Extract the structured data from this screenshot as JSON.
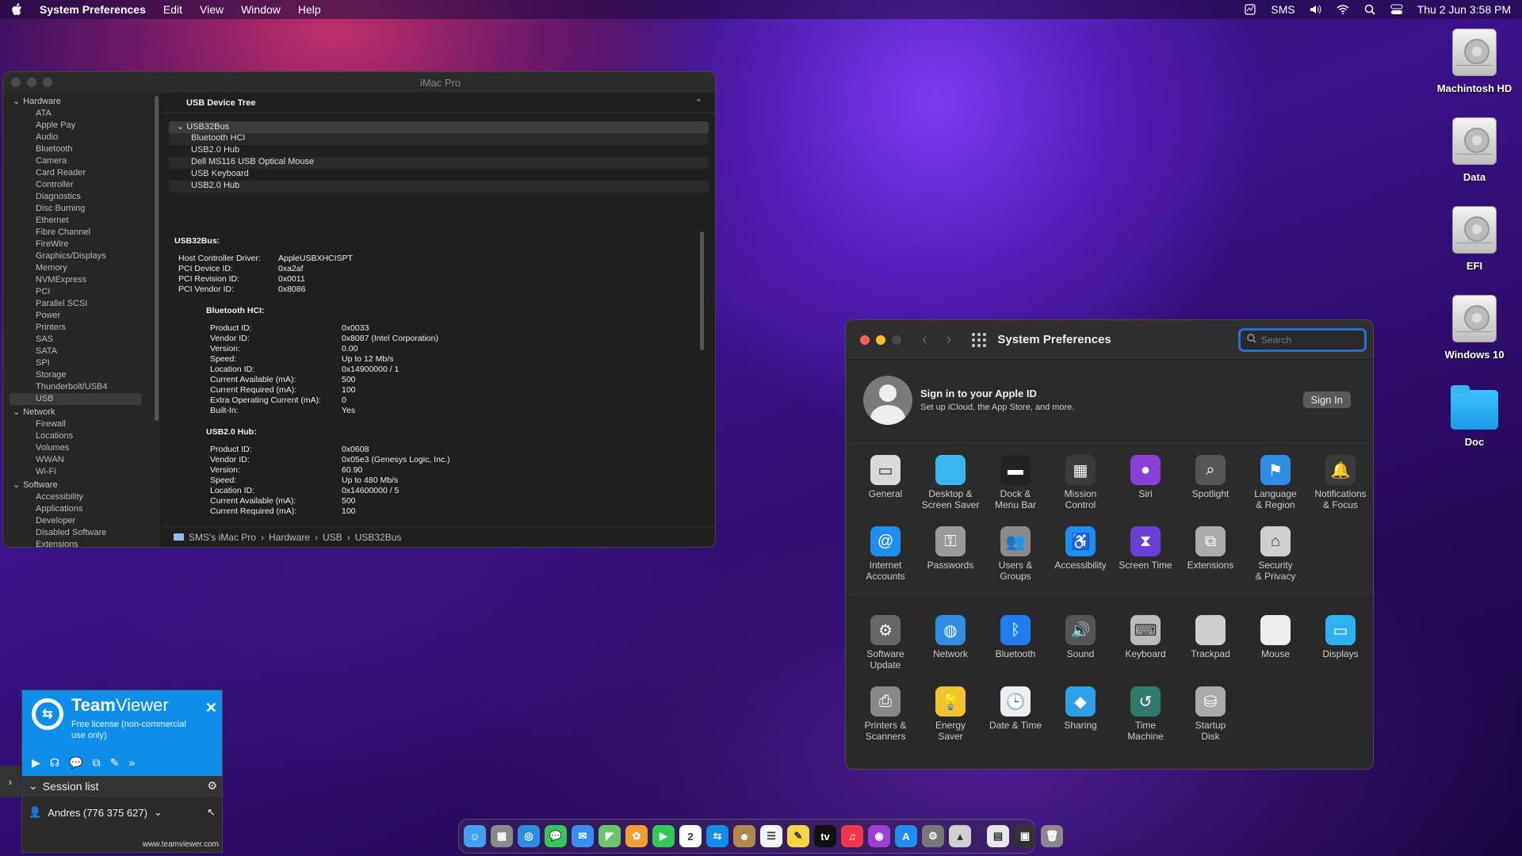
{
  "menubar": {
    "app_name": "System Preferences",
    "menus": [
      "Edit",
      "View",
      "Window",
      "Help"
    ],
    "status_text": "SMS",
    "clock": "Thu 2 Jun  3:58 PM"
  },
  "desktop": {
    "icons": [
      {
        "label": "Machintosh HD",
        "kind": "disk"
      },
      {
        "label": "Data",
        "kind": "disk"
      },
      {
        "label": "EFI",
        "kind": "disk"
      },
      {
        "label": "Windows 10",
        "kind": "disk"
      },
      {
        "label": "Doc",
        "kind": "folder"
      }
    ]
  },
  "sysinfo": {
    "title": "iMac Pro",
    "sidebar": {
      "hardware_label": "Hardware",
      "hardware": [
        "ATA",
        "Apple Pay",
        "Audio",
        "Bluetooth",
        "Camera",
        "Card Reader",
        "Controller",
        "Diagnostics",
        "Disc Burning",
        "Ethernet",
        "Fibre Channel",
        "FireWire",
        "Graphics/Displays",
        "Memory",
        "NVMExpress",
        "PCI",
        "Parallel SCSI",
        "Power",
        "Printers",
        "SAS",
        "SATA",
        "SPI",
        "Storage",
        "Thunderbolt/USB4",
        "USB"
      ],
      "network_label": "Network",
      "network": [
        "Firewall",
        "Locations",
        "Volumes",
        "WWAN",
        "Wi-Fi"
      ],
      "software_label": "Software",
      "software": [
        "Accessibility",
        "Applications",
        "Developer",
        "Disabled Software",
        "Extensions"
      ]
    },
    "tree_header": "USB Device Tree",
    "tree": {
      "root": "USB32Bus",
      "children": [
        "Bluetooth HCI",
        "USB2.0 Hub",
        "Dell MS116 USB Optical Mouse",
        "USB Keyboard",
        "USB2.0 Hub"
      ]
    },
    "detail": {
      "heading": "USB32Bus:",
      "fields": [
        {
          "k": "Host Controller Driver:",
          "v": "AppleUSBXHCISPT"
        },
        {
          "k": "PCI Device ID:",
          "v": "0xa2af"
        },
        {
          "k": "PCI Revision ID:",
          "v": "0x0011"
        },
        {
          "k": "PCI Vendor ID:",
          "v": "0x8086"
        }
      ],
      "bt_heading": "Bluetooth HCI:",
      "bt_fields": [
        {
          "k": "Product ID:",
          "v": "0x0033"
        },
        {
          "k": "Vendor ID:",
          "v": "0x8087  (Intel Corporation)"
        },
        {
          "k": "Version:",
          "v": "0.00"
        },
        {
          "k": "Speed:",
          "v": "Up to 12 Mb/s"
        },
        {
          "k": "Location ID:",
          "v": "0x14900000 / 1"
        },
        {
          "k": "Current Available (mA):",
          "v": "500"
        },
        {
          "k": "Current Required (mA):",
          "v": "100"
        },
        {
          "k": "Extra Operating Current (mA):",
          "v": "0"
        },
        {
          "k": "Built-In:",
          "v": "Yes"
        }
      ],
      "hub_heading": "USB2.0 Hub:",
      "hub_fields": [
        {
          "k": "Product ID:",
          "v": "0x0608"
        },
        {
          "k": "Vendor ID:",
          "v": "0x05e3  (Genesys Logic, Inc.)"
        },
        {
          "k": "Version:",
          "v": "60.90"
        },
        {
          "k": "Speed:",
          "v": "Up to 480 Mb/s"
        },
        {
          "k": "Location ID:",
          "v": "0x14600000 / 5"
        },
        {
          "k": "Current Available (mA):",
          "v": "500"
        },
        {
          "k": "Current Required (mA):",
          "v": "100"
        }
      ]
    },
    "path": [
      "SMS's iMac Pro",
      "Hardware",
      "USB",
      "USB32Bus"
    ]
  },
  "sysprefs": {
    "title": "System Preferences",
    "search_placeholder": "Search",
    "signin_title": "Sign in to your Apple ID",
    "signin_sub": "Set up iCloud, the App Store, and more.",
    "signin_button": "Sign In",
    "section1": [
      {
        "label": "General",
        "icon": "general-icon",
        "color": "#d9d9d9",
        "glyph": "▭"
      },
      {
        "label": "Desktop &\nScreen Saver",
        "icon": "desktop-icon",
        "color": "#38b6f0",
        "glyph": ""
      },
      {
        "label": "Dock &\nMenu Bar",
        "icon": "dock-icon",
        "color": "#222222",
        "glyph": "▬"
      },
      {
        "label": "Mission\nControl",
        "icon": "mission-control-icon",
        "color": "#3a3a3a",
        "glyph": "▦"
      },
      {
        "label": "Siri",
        "icon": "siri-icon",
        "color": "#8a3fd6",
        "glyph": "●"
      },
      {
        "label": "Spotlight",
        "icon": "spotlight-icon",
        "color": "#555555",
        "glyph": "⌕"
      },
      {
        "label": "Language\n& Region",
        "icon": "language-icon",
        "color": "#2f8de4",
        "glyph": "⚑"
      },
      {
        "label": "Notifications\n& Focus",
        "icon": "notifications-icon",
        "color": "#3a3a3a",
        "glyph": "🔔"
      },
      {
        "label": "Internet\nAccounts",
        "icon": "internet-accounts-icon",
        "color": "#1e8ef0",
        "glyph": "@"
      },
      {
        "label": "Passwords",
        "icon": "passwords-icon",
        "color": "#9a9a9a",
        "glyph": "⚿"
      },
      {
        "label": "Users &\nGroups",
        "icon": "users-icon",
        "color": "#8a8a8a",
        "glyph": "👥"
      },
      {
        "label": "Accessibility",
        "icon": "accessibility-icon",
        "color": "#1e8ef0",
        "glyph": "♿"
      },
      {
        "label": "Screen Time",
        "icon": "screen-time-icon",
        "color": "#6a3fd6",
        "glyph": "⧗"
      },
      {
        "label": "Extensions",
        "icon": "extensions-icon",
        "color": "#aaaaaa",
        "glyph": "⧉"
      },
      {
        "label": "Security\n& Privacy",
        "icon": "security-icon",
        "color": "#d0d0d0",
        "glyph": "⌂"
      }
    ],
    "section2": [
      {
        "label": "Software\nUpdate",
        "icon": "software-update-icon",
        "color": "#666666",
        "glyph": "⚙"
      },
      {
        "label": "Network",
        "icon": "network-icon",
        "color": "#2f8de4",
        "glyph": "◍"
      },
      {
        "label": "Bluetooth",
        "icon": "bluetooth-icon",
        "color": "#1e7ef0",
        "glyph": "ᛒ"
      },
      {
        "label": "Sound",
        "icon": "sound-icon",
        "color": "#555555",
        "glyph": "🔊"
      },
      {
        "label": "Keyboard",
        "icon": "keyboard-icon",
        "color": "#bbbbbb",
        "glyph": "⌨"
      },
      {
        "label": "Trackpad",
        "icon": "trackpad-icon",
        "color": "#cfcfcf",
        "glyph": ""
      },
      {
        "label": "Mouse",
        "icon": "mouse-icon",
        "color": "#eeeeee",
        "glyph": ""
      },
      {
        "label": "Displays",
        "icon": "displays-icon",
        "color": "#2fb0f0",
        "glyph": "▭"
      },
      {
        "label": "Printers &\nScanners",
        "icon": "printers-icon",
        "color": "#888888",
        "glyph": "⎙"
      },
      {
        "label": "Energy\nSaver",
        "icon": "energy-saver-icon",
        "color": "#f1c232",
        "glyph": "💡"
      },
      {
        "label": "Date & Time",
        "icon": "date-time-icon",
        "color": "#eeeeee",
        "glyph": "🕒"
      },
      {
        "label": "Sharing",
        "icon": "sharing-icon",
        "color": "#2fa0e6",
        "glyph": "◆"
      },
      {
        "label": "Time\nMachine",
        "icon": "time-machine-icon",
        "color": "#2f7a6a",
        "glyph": "↺"
      },
      {
        "label": "Startup\nDisk",
        "icon": "startup-disk-icon",
        "color": "#aaaaaa",
        "glyph": "⛁"
      }
    ]
  },
  "teamviewer": {
    "name_bold": "Team",
    "name_light": "Viewer",
    "license": "Free license (non-commercial use only)",
    "session_list": "Session list",
    "user": "Andres (776 375 627)",
    "url": "www.teamviewer.com"
  },
  "dock": {
    "items": [
      {
        "icon": "finder-icon",
        "color": "#3fa0f0",
        "glyph": "☺"
      },
      {
        "icon": "launchpad-icon",
        "color": "#8a8a8a",
        "glyph": "▦"
      },
      {
        "icon": "safari-icon",
        "color": "#2f8de4",
        "glyph": "◎"
      },
      {
        "icon": "messages-icon",
        "color": "#34c759",
        "glyph": "💬"
      },
      {
        "icon": "mail-icon",
        "color": "#3a8ef0",
        "glyph": "✉"
      },
      {
        "icon": "maps-icon",
        "color": "#6ac46a",
        "glyph": "◤"
      },
      {
        "icon": "photos-icon",
        "color": "#f0a030",
        "glyph": "✿"
      },
      {
        "icon": "facetime-icon",
        "color": "#34c759",
        "glyph": "▶"
      },
      {
        "icon": "calendar-icon",
        "color": "#ffffff",
        "glyph": "2"
      },
      {
        "icon": "teamviewer-icon",
        "color": "#0e8ee9",
        "glyph": "⇆"
      },
      {
        "icon": "contacts-icon",
        "color": "#b08850",
        "glyph": "☻"
      },
      {
        "icon": "reminders-icon",
        "color": "#f5f5f5",
        "glyph": "☰"
      },
      {
        "icon": "notes-icon",
        "color": "#f5d547",
        "glyph": "✎"
      },
      {
        "icon": "tv-icon",
        "color": "#111111",
        "glyph": "tv"
      },
      {
        "icon": "music-icon",
        "color": "#f0364a",
        "glyph": "♫"
      },
      {
        "icon": "podcasts-icon",
        "color": "#9a3fd6",
        "glyph": "◉"
      },
      {
        "icon": "app-store-icon",
        "color": "#1e8ef0",
        "glyph": "A"
      },
      {
        "icon": "system-preferences-icon",
        "color": "#777777",
        "glyph": "⚙"
      },
      {
        "icon": "preview-icon",
        "color": "#d0d0d0",
        "glyph": "▲"
      }
    ],
    "tail": [
      {
        "icon": "document-icon",
        "color": "#e8e8e8",
        "glyph": "▤"
      },
      {
        "icon": "screenshot-icon",
        "color": "#333333",
        "glyph": "▣"
      },
      {
        "icon": "trash-icon",
        "color": "#8a8a8a",
        "glyph": "🗑"
      }
    ]
  }
}
